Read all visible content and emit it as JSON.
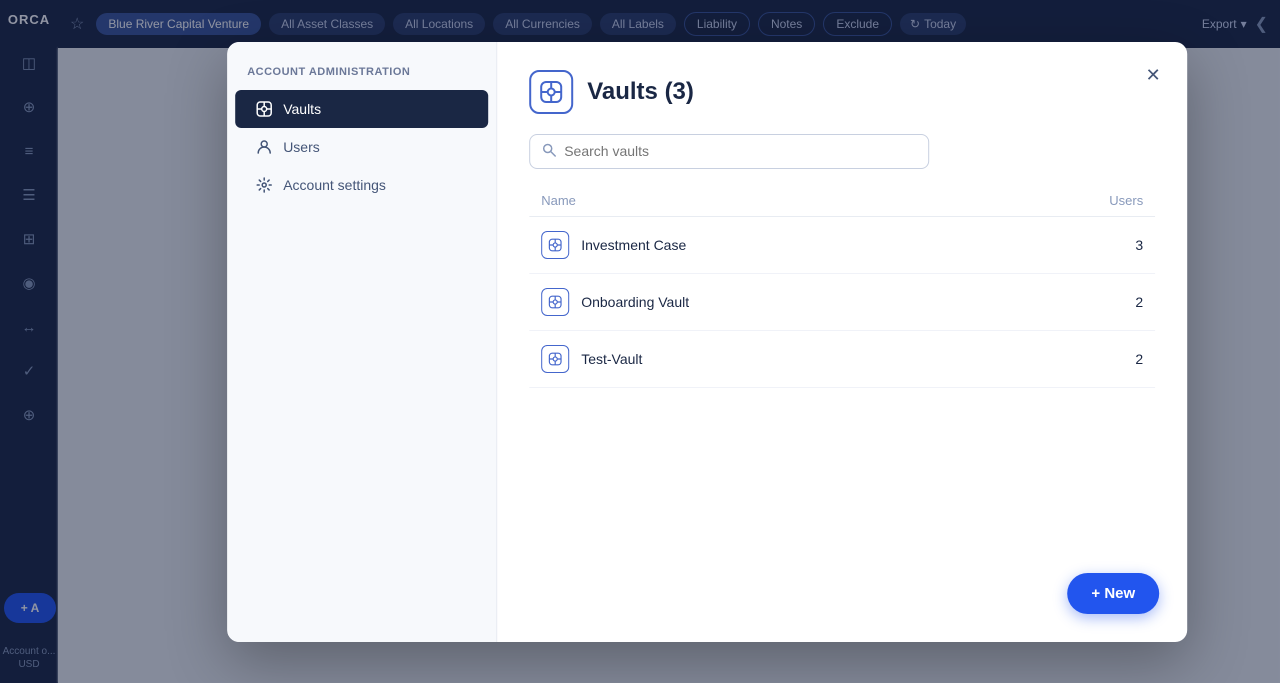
{
  "app": {
    "logo": "ORCA"
  },
  "topbar": {
    "star_label": "★",
    "chips": [
      {
        "label": "Blue River Capital Venture",
        "active": true
      },
      {
        "label": "All Asset Classes",
        "active": false
      },
      {
        "label": "All Locations",
        "active": false
      },
      {
        "label": "All Currencies",
        "active": false
      },
      {
        "label": "All Labels",
        "active": false
      },
      {
        "label": "Liability",
        "active": false
      },
      {
        "label": "Notes",
        "active": false
      },
      {
        "label": "Exclude",
        "active": false
      }
    ],
    "today_label": "Today",
    "export_label": "Export"
  },
  "sidebar": {
    "nav_items": [
      {
        "icon": "◫",
        "name": "investments"
      },
      {
        "icon": "⊕",
        "name": "search"
      },
      {
        "icon": "≡",
        "name": "strategy"
      },
      {
        "icon": "☰",
        "name": "list"
      },
      {
        "icon": "⊞",
        "name": "files"
      },
      {
        "icon": "◉",
        "name": "camera"
      },
      {
        "icon": "↔",
        "name": "transactions"
      },
      {
        "icon": "✓",
        "name": "tasks"
      },
      {
        "icon": "⊕",
        "name": "more"
      }
    ],
    "account_label": "Account o...",
    "currency_label": "USD"
  },
  "modal": {
    "admin_header": "Account administration",
    "nav_items": [
      {
        "label": "Vaults",
        "icon": "⊟",
        "active": true
      },
      {
        "label": "Users",
        "icon": "👤",
        "active": false
      },
      {
        "label": "Account settings",
        "icon": "⚙",
        "active": false
      }
    ],
    "title": "Vaults (3)",
    "search_placeholder": "Search vaults",
    "table": {
      "col_name": "Name",
      "col_users": "Users",
      "rows": [
        {
          "name": "Investment Case",
          "users": 3
        },
        {
          "name": "Onboarding Vault",
          "users": 2
        },
        {
          "name": "Test-Vault",
          "users": 2
        }
      ]
    },
    "new_button_label": "+ New",
    "close_label": "✕"
  }
}
